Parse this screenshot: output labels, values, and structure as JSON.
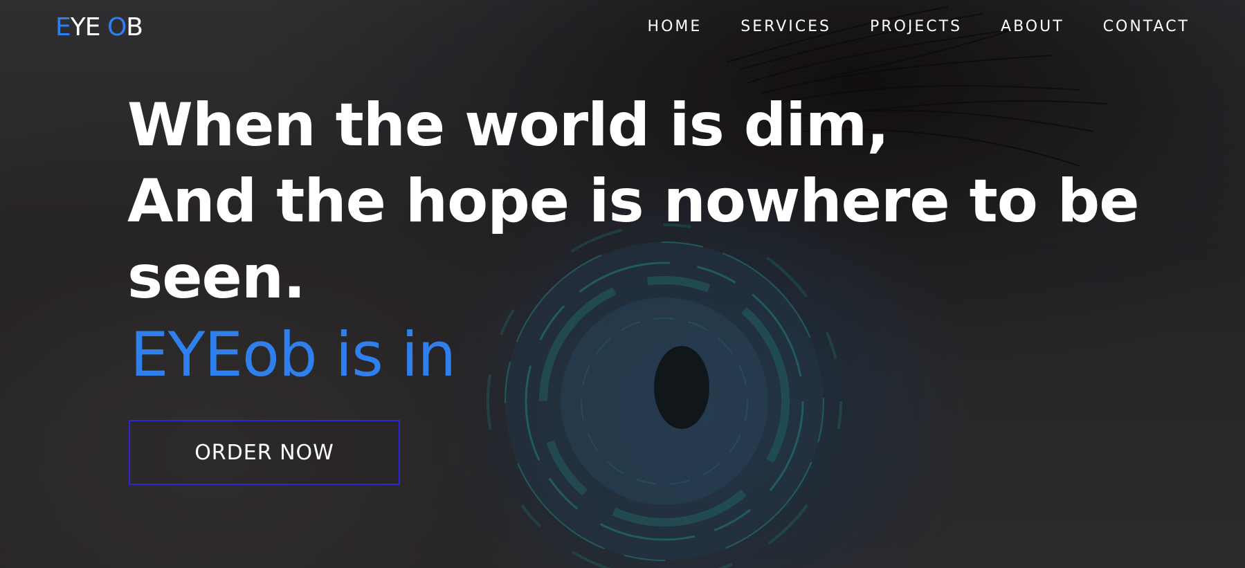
{
  "logo": {
    "letter_1": "E",
    "part_1": "YE ",
    "letter_2": "O",
    "part_2": "B"
  },
  "nav": {
    "items": [
      {
        "label": "HOME"
      },
      {
        "label": "SERVICES"
      },
      {
        "label": "PROJECTS"
      },
      {
        "label": "ABOUT"
      },
      {
        "label": "CONTACT"
      }
    ]
  },
  "hero": {
    "headline_lines": [
      "When the world is dim,",
      "And the hope is nowhere to be",
      "seen."
    ],
    "tagline": "EYEob is in",
    "cta_label": "ORDER NOW"
  },
  "colors": {
    "accent": "#2f80ed",
    "button_border": "#2d25d6",
    "text": "#ffffff",
    "background": "#2e2c2f"
  }
}
